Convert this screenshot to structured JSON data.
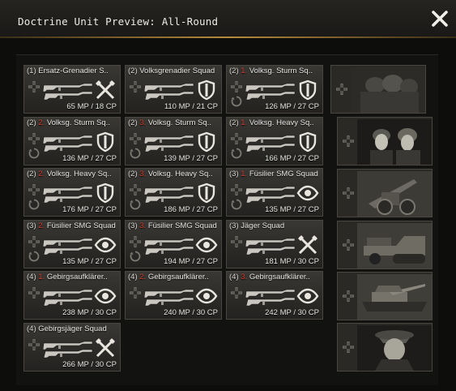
{
  "window": {
    "title": "Doctrine Unit Preview: All-Round"
  },
  "units": [
    {
      "vet": "(1)",
      "rank": "",
      "name": "Ersatz-Grenadier S..",
      "cost": "65 MP / 18 CP",
      "role": "crossed-rifles",
      "reinforce": false
    },
    {
      "vet": "(2)",
      "rank": "",
      "name": "Volksgrenadier Squad",
      "cost": "110 MP / 21 CP",
      "role": "shield",
      "reinforce": false
    },
    {
      "vet": "(2)",
      "rank": "1.",
      "name": "Volksg. Sturm Sq..",
      "cost": "126 MP / 27 CP",
      "role": "shield",
      "reinforce": true
    },
    {
      "vet": "(2)",
      "rank": "2.",
      "name": "Volksg. Sturm Sq..",
      "cost": "136 MP / 27 CP",
      "role": "shield",
      "reinforce": true
    },
    {
      "vet": "(2)",
      "rank": "3.",
      "name": "Volksg. Sturm Sq..",
      "cost": "139 MP / 27 CP",
      "role": "shield",
      "reinforce": true
    },
    {
      "vet": "(2)",
      "rank": "1.",
      "name": "Volksg. Heavy Sq..",
      "cost": "166 MP / 27 CP",
      "role": "shield",
      "reinforce": true
    },
    {
      "vet": "(2)",
      "rank": "2.",
      "name": "Volksg. Heavy Sq..",
      "cost": "176 MP / 27 CP",
      "role": "shield",
      "reinforce": true
    },
    {
      "vet": "(2)",
      "rank": "3.",
      "name": "Volksg. Heavy Sq..",
      "cost": "186 MP / 27 CP",
      "role": "shield",
      "reinforce": true
    },
    {
      "vet": "(3)",
      "rank": "1.",
      "name": "Füsilier SMG Squad",
      "cost": "135 MP / 27 CP",
      "role": "eye",
      "reinforce": true
    },
    {
      "vet": "(3)",
      "rank": "2.",
      "name": "Füsilier SMG Squad",
      "cost": "135 MP / 27 CP",
      "role": "eye",
      "reinforce": true
    },
    {
      "vet": "(3)",
      "rank": "3.",
      "name": "Füsilier SMG Squad",
      "cost": "194 MP / 27 CP",
      "role": "eye",
      "reinforce": true
    },
    {
      "vet": "(3)",
      "rank": "",
      "name": "Jäger Squad",
      "cost": "181 MP / 30 CP",
      "role": "crossed-rifles",
      "reinforce": false
    },
    {
      "vet": "(4)",
      "rank": "1.",
      "name": "Gebirgsaufklärer..",
      "cost": "238 MP / 30 CP",
      "role": "eye",
      "reinforce": false
    },
    {
      "vet": "(4)",
      "rank": "2.",
      "name": "Gebirgsaufklärer..",
      "cost": "240 MP / 30 CP",
      "role": "eye",
      "reinforce": false
    },
    {
      "vet": "(4)",
      "rank": "3.",
      "name": "Gebirgsaufklärer..",
      "cost": "242 MP / 30 CP",
      "role": "eye",
      "reinforce": false
    },
    {
      "vet": "(4)",
      "rank": "",
      "name": "Gebirgsjäger Squad",
      "cost": "266 MP / 30 CP",
      "role": "crossed-rifles",
      "reinforce": false
    }
  ],
  "abilities": [
    {
      "icon": "soldier-group-portrait"
    },
    {
      "icon": "soldier-pair-portrait"
    },
    {
      "icon": "field-gun-portrait"
    },
    {
      "icon": "halftrack-portrait"
    },
    {
      "icon": "tank-destroyer-portrait"
    },
    {
      "icon": "officer-portrait"
    }
  ],
  "colors": {
    "accent": "#b68a3c",
    "rank_red": "#d33c2c"
  }
}
